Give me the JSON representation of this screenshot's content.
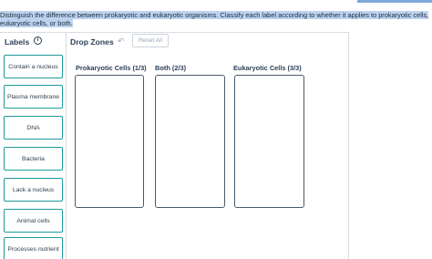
{
  "instructions": "Distinguish the difference between prokaryotic and eukaryotic organisms. Classify each label according to whether it applies to prokaryotic cells, eukaryotic cells, or both.",
  "labels_panel": {
    "title": "Labels",
    "info_icon": "info-circle-icon",
    "items": [
      {
        "label": "Contain a nucleus"
      },
      {
        "label": "Plasma membrane"
      },
      {
        "label": "DNA"
      },
      {
        "label": "Bacteria"
      },
      {
        "label": "Lack a nucleus"
      },
      {
        "label": "Animal cells"
      },
      {
        "label": "Processes nutrient"
      }
    ]
  },
  "drop_zones": {
    "title": "Drop Zones",
    "undo_icon": "undo-icon",
    "reset_label": "Reset All",
    "zones": [
      {
        "label": "Prokaryotic Cells (1/3)"
      },
      {
        "label": "Both (2/3)"
      },
      {
        "label": "Eukaryotic Cells (3/3)"
      }
    ]
  },
  "colors": {
    "label_border": "#1d9a9c",
    "highlight": "#bcd3ef",
    "zone_border": "#4a5a6c"
  }
}
